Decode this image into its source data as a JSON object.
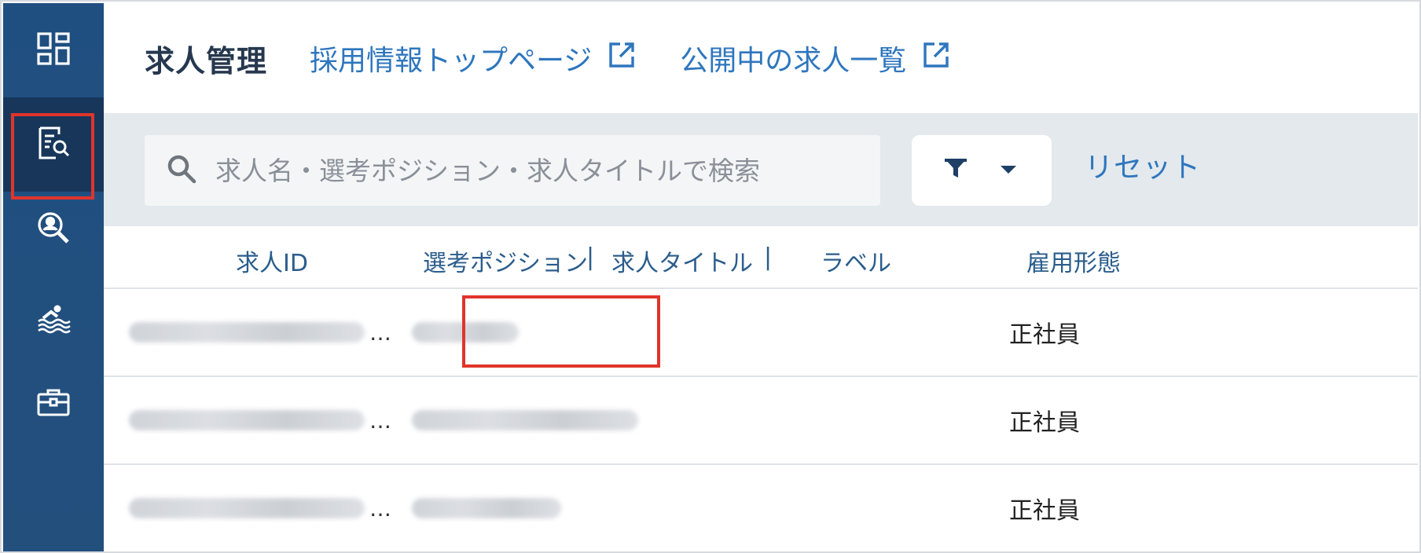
{
  "header": {
    "title": "求人管理",
    "links": [
      {
        "label": "採用情報トップページ",
        "icon": "external-link-icon"
      },
      {
        "label": "公開中の求人一覧",
        "icon": "external-link-icon"
      }
    ]
  },
  "sidebar": {
    "items": [
      {
        "icon": "dashboard-grid-icon",
        "active": false
      },
      {
        "icon": "job-search-document-icon",
        "active": true,
        "highlighted": true
      },
      {
        "icon": "candidate-search-icon",
        "active": false
      },
      {
        "icon": "swimmer-icon",
        "active": false
      },
      {
        "icon": "briefcase-icon",
        "active": false
      }
    ]
  },
  "search": {
    "placeholder": "求人名・選考ポジション・求人タイトルで検索",
    "value": ""
  },
  "filter": {
    "icon": "filter-funnel-icon",
    "caret": "caret-down-icon"
  },
  "reset_label": "リセット",
  "table": {
    "columns": {
      "job_id": "求人ID",
      "position": "選考ポジション",
      "sep1": "|",
      "job_title": "求人タイトル",
      "sep2": "|",
      "label": "ラベル",
      "employment_type": "雇用形態"
    },
    "rows": [
      {
        "job_id_ellipsis": "…",
        "employment_type": "正社員"
      },
      {
        "job_id_ellipsis": "…",
        "employment_type": "正社員"
      },
      {
        "job_id_ellipsis": "…",
        "employment_type": "正社員"
      }
    ]
  },
  "colors": {
    "sidebar": "#1f4f80",
    "sidebar_active": "#17365a",
    "link": "#2e76be",
    "highlight": "#e0342c",
    "toolbar_bg": "#e3e9ed"
  }
}
